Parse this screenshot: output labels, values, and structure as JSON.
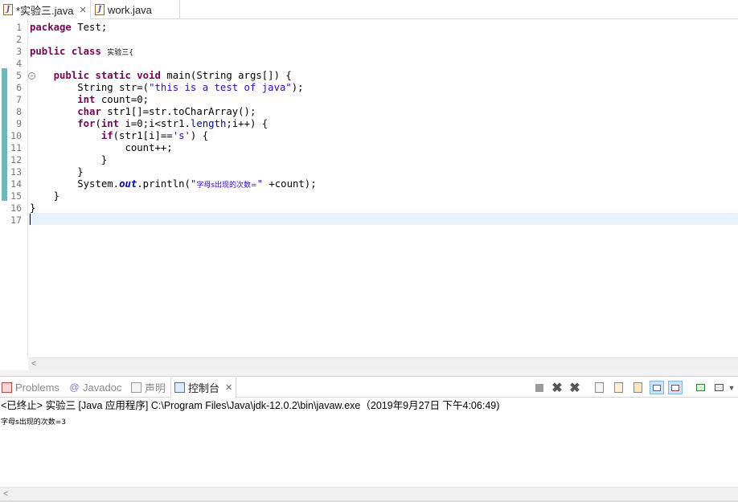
{
  "editor_tabs": [
    {
      "label": "*实验三.java",
      "active": true
    },
    {
      "label": "work.java",
      "active": false
    }
  ],
  "line_numbers": [
    "1",
    "2",
    "3",
    "4",
    "5",
    "6",
    "7",
    "8",
    "9",
    "10",
    "11",
    "12",
    "13",
    "14",
    "15",
    "16",
    "17"
  ],
  "code": {
    "l1_kw": "package",
    "l1_rest": " Test;",
    "l3_kw1": "public",
    "l3_kw2": "class",
    "l3_name": "实验三",
    "l3_rest": "{",
    "l5_kw1": "public",
    "l5_kw2": "static",
    "l5_kw3": "void",
    "l5_rest": " main(String args[]) {",
    "l6_pre": "String ",
    "l6_var": "str",
    "l6_mid": "=(",
    "l6_str": "\"this is a test of java\"",
    "l6_end": ");",
    "l7_kw": "int",
    "l7_rest": " count=0;",
    "l8_kw": "char",
    "l8_rest": " str1[]=str.toCharArray();",
    "l9_kw1": "for",
    "l9_a": "(",
    "l9_kw2": "int",
    "l9_b": " i=0;i<str1.",
    "l9_fld": "length",
    "l9_c": ";i++) {",
    "l10_kw": "if",
    "l10_a": "(str1[i]==",
    "l10_str": "'s'",
    "l10_b": ") {",
    "l11": "count++;",
    "l12": "}",
    "l13": "}",
    "l14_a": "System.",
    "l14_fld": "out",
    "l14_b": ".println(",
    "l14_str_q": "\"",
    "l14_str_cn": "字母s出现的次数=",
    "l14_str_q2": "\"",
    "l14_c": " +count);",
    "l15": "}",
    "l16": "}"
  },
  "panel_tabs": [
    {
      "label": "Problems",
      "icon": "problems-icon"
    },
    {
      "label": "Javadoc",
      "icon": "javadoc-icon"
    },
    {
      "label": "声明",
      "icon": "declaration-icon"
    },
    {
      "label": "控制台",
      "icon": "console-icon",
      "active": true
    }
  ],
  "console": {
    "header": "<已终止> 实验三 [Java 应用程序] C:\\Program Files\\Java\\jdk-12.0.2\\bin\\javaw.exe（2019年9月27日 下午4:06:49)",
    "output": "字母s出现的次数=3"
  },
  "colors": {
    "keyword": "#7f0055",
    "string": "#2a00ff",
    "field": "#0000c0",
    "current_line": "#e8f2fe",
    "change_marker": "#6fb7bd"
  }
}
